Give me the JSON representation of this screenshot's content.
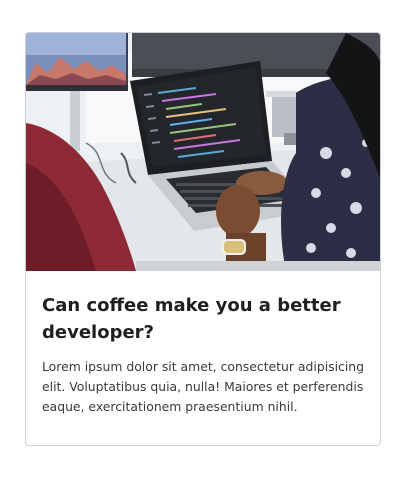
{
  "card": {
    "image_description_icon": "photo-laptop-code",
    "title": "Can coffee make you a better developer?",
    "text": "Lorem ipsum dolor sit amet, consectetur adipisicing elit. Voluptatibus quia, nulla! Maiores et perferendis eaque, exercitationem praesentium nihil."
  },
  "colors": {
    "border": "#cfcfcf",
    "title": "#1f1f1f",
    "text": "#3a3a3a"
  }
}
